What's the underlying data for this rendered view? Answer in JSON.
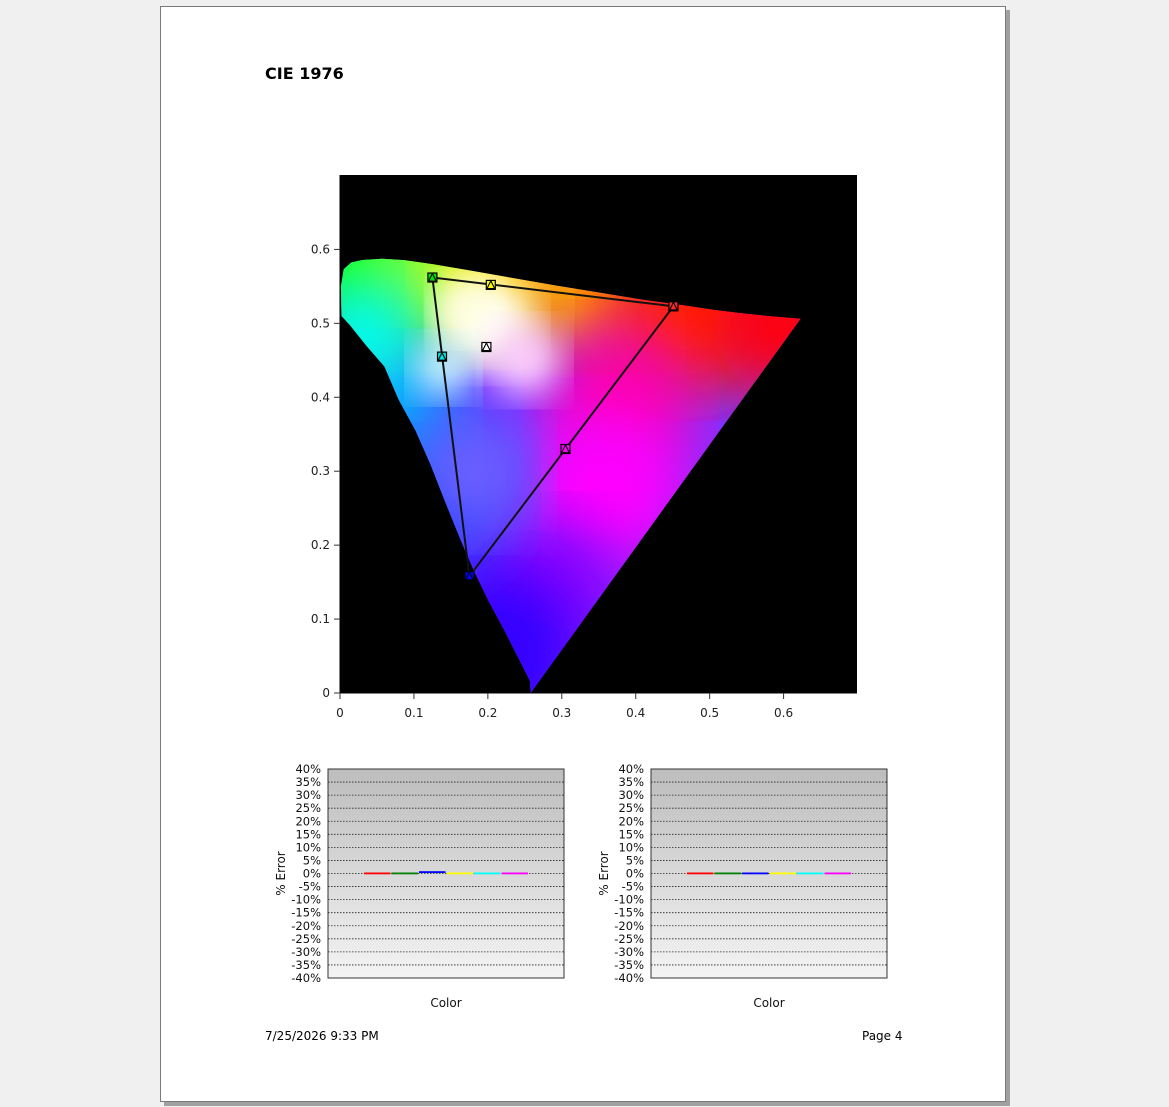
{
  "report": {
    "title": "CIE 1976",
    "footer_date": "7/25/2026 9:33 PM",
    "footer_page": "Page 4"
  },
  "chart_data": [
    {
      "type": "scatter",
      "name_hint": "cie-1976-uv-diagram",
      "background": "#000000",
      "xlim": [
        0,
        0.7
      ],
      "ylim": [
        0,
        0.7
      ],
      "x_ticks": [
        0,
        0.1,
        0.2,
        0.3,
        0.4,
        0.5,
        0.6
      ],
      "y_ticks": [
        0,
        0.1,
        0.2,
        0.3,
        0.4,
        0.5,
        0.6
      ],
      "gamut_triangle": [
        {
          "u": 0.451,
          "v": 0.523
        },
        {
          "u": 0.125,
          "v": 0.562
        },
        {
          "u": 0.175,
          "v": 0.158
        }
      ],
      "points": [
        {
          "u": 0.451,
          "v": 0.523,
          "color": "#ff2a2a"
        },
        {
          "u": 0.204,
          "v": 0.552,
          "color": "#ffff00"
        },
        {
          "u": 0.125,
          "v": 0.562,
          "color": "#00e000"
        },
        {
          "u": 0.138,
          "v": 0.455,
          "color": "#00e0e0"
        },
        {
          "u": 0.175,
          "v": 0.158,
          "color": "#0000ff"
        },
        {
          "u": 0.305,
          "v": 0.33,
          "color": "#ff00ff"
        },
        {
          "u": 0.198,
          "v": 0.468,
          "color": "#ffffff"
        }
      ]
    },
    {
      "type": "bar",
      "name_hint": "error-chart-left",
      "ylabel": "% Error",
      "xlabel": "Color",
      "ylim": [
        -40,
        40
      ],
      "y_tick_labels": [
        "40%",
        "35%",
        "30%",
        "25%",
        "20%",
        "15%",
        "10%",
        "5%",
        "0%",
        "-5%",
        "-10%",
        "-15%",
        "-20%",
        "-25%",
        "-30%",
        "-35%",
        "-40%"
      ],
      "series": [
        {
          "color": "#ff0000",
          "value": 0.0
        },
        {
          "color": "#008000",
          "value": -0.3
        },
        {
          "color": "#0000ff",
          "value": 0.5
        },
        {
          "color": "#ffff00",
          "value": 0.0
        },
        {
          "color": "#00ffff",
          "value": 0.0
        },
        {
          "color": "#ff00ff",
          "value": 0.0
        }
      ]
    },
    {
      "type": "bar",
      "name_hint": "error-chart-right",
      "ylabel": "% Error",
      "xlabel": "Color",
      "ylim": [
        -40,
        40
      ],
      "y_tick_labels": [
        "40%",
        "35%",
        "30%",
        "25%",
        "20%",
        "15%",
        "10%",
        "5%",
        "0%",
        "-5%",
        "-10%",
        "-15%",
        "-20%",
        "-25%",
        "-30%",
        "-35%",
        "-40%"
      ],
      "series": [
        {
          "color": "#ff0000",
          "value": 0.0
        },
        {
          "color": "#008000",
          "value": 0.0
        },
        {
          "color": "#0000ff",
          "value": -0.4
        },
        {
          "color": "#ffff00",
          "value": 0.0
        },
        {
          "color": "#00ffff",
          "value": 0.0
        },
        {
          "color": "#ff00ff",
          "value": -0.2
        }
      ]
    }
  ]
}
